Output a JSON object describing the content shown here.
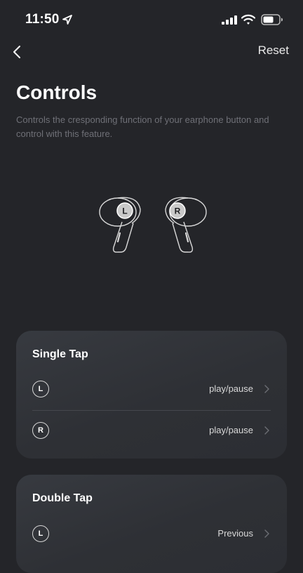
{
  "status_bar": {
    "time": "11:50"
  },
  "nav": {
    "reset_label": "Reset"
  },
  "header": {
    "title": "Controls",
    "description": "Controls the cresponding function of your earphone button and control with this feature."
  },
  "earbuds": {
    "left_label": "L",
    "right_label": "R"
  },
  "sections": [
    {
      "title": "Single Tap",
      "rows": [
        {
          "side": "L",
          "value": "play/pause"
        },
        {
          "side": "R",
          "value": "play/pause"
        }
      ]
    },
    {
      "title": "Double Tap",
      "rows": [
        {
          "side": "L",
          "value": "Previous"
        }
      ]
    }
  ]
}
